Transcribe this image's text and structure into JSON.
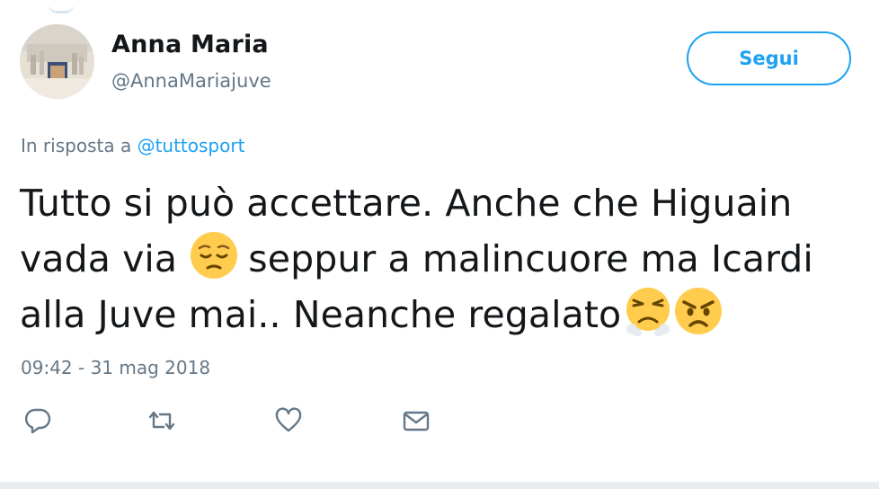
{
  "user": {
    "name": "Anna Maria",
    "handle": "@AnnaMariajuve",
    "avatar": "avatar-image"
  },
  "follow_button": {
    "label": "Segui"
  },
  "reply": {
    "prefix": "In risposta a ",
    "mention": "@tuttosport"
  },
  "tweet": {
    "line1": "Tutto si può accettare. Anche che Higuain",
    "line2_a": "vada via",
    "line2_b": "seppur a malincuore ma Icardi",
    "line3": "alla Juve mai.. Neanche regalato",
    "emojis": [
      "pensive-face",
      "steam-from-nose-face",
      "angry-face"
    ]
  },
  "timestamp": "09:42 - 31 mag 2018",
  "actions": [
    "reply-icon",
    "retweet-icon",
    "like-icon",
    "direct-message-icon"
  ],
  "colors": {
    "accent": "#1da1f2",
    "text": "#14171a",
    "secondary": "#657786",
    "emoji_yellow": "#ffcc4d"
  }
}
